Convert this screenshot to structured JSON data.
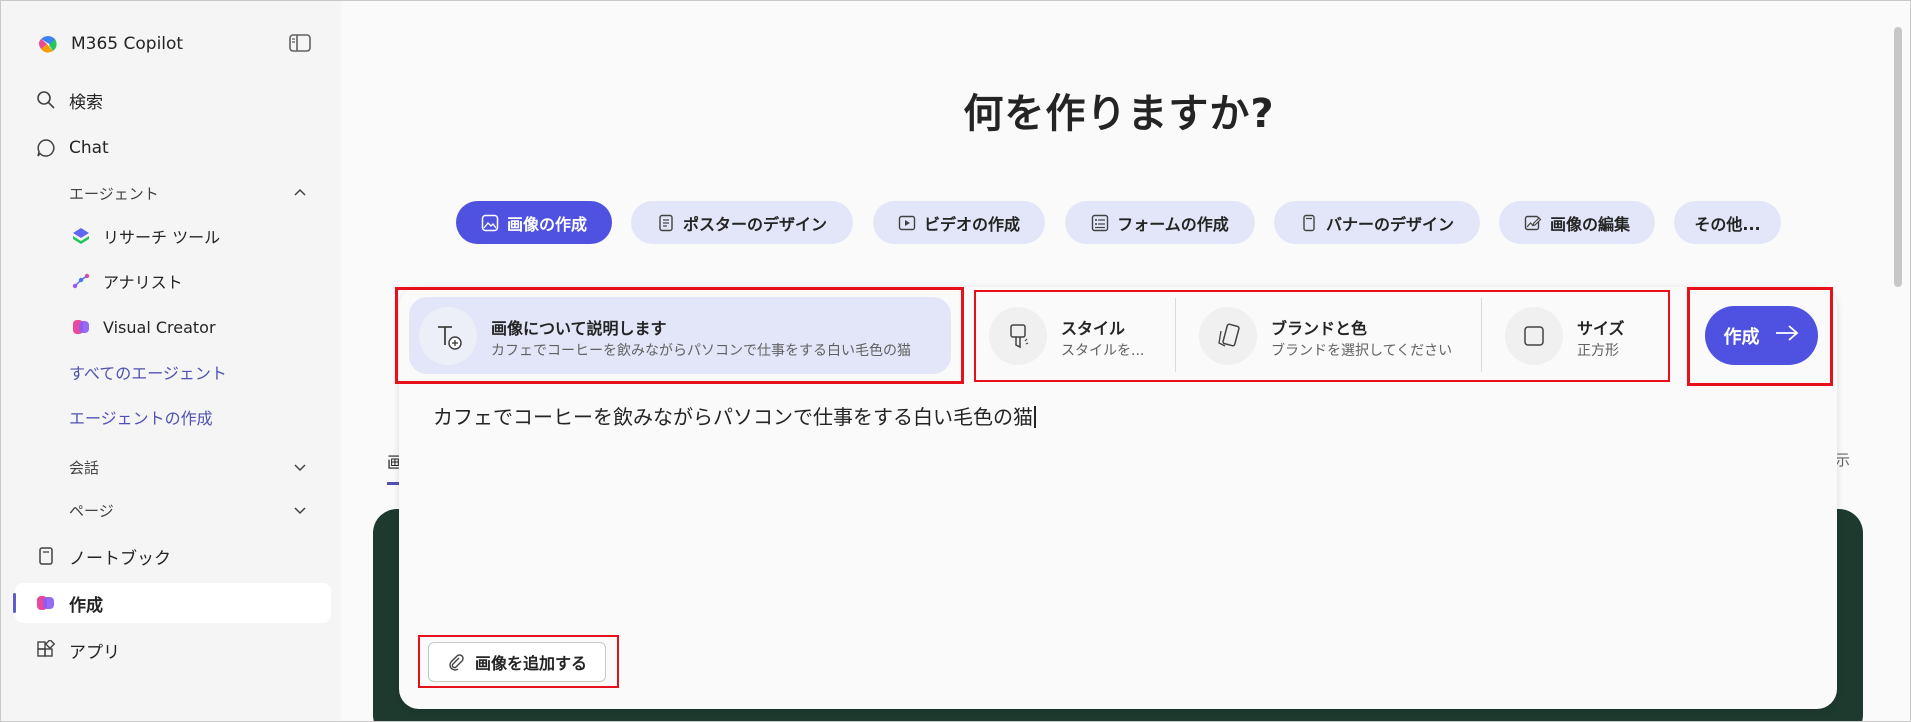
{
  "app": {
    "title": "M365 Copilot"
  },
  "sidebar": {
    "items": [
      {
        "label": "検索",
        "icon": "search-icon"
      },
      {
        "label": "Chat",
        "icon": "chat-icon"
      },
      {
        "label": "ノートブック",
        "icon": "notebook-icon"
      },
      {
        "label": "作成",
        "icon": "create-icon"
      },
      {
        "label": "アプリ",
        "icon": "apps-icon"
      }
    ],
    "agents_header": "エージェント",
    "agents": [
      {
        "label": "リサーチ ツール",
        "icon": "research-agent-icon"
      },
      {
        "label": "アナリスト",
        "icon": "analyst-agent-icon"
      },
      {
        "label": "Visual Creator",
        "icon": "visual-creator-icon"
      }
    ],
    "all_agents": "すべてのエージェント",
    "create_agent": "エージェントの作成",
    "conversations": "会話",
    "pages": "ページ"
  },
  "main": {
    "heading": "何を作りますか?",
    "pills": [
      {
        "label": "画像の作成",
        "icon": "image-icon",
        "active": true
      },
      {
        "label": "ポスターのデザイン",
        "icon": "poster-icon"
      },
      {
        "label": "ビデオの作成",
        "icon": "video-icon"
      },
      {
        "label": "フォームの作成",
        "icon": "form-icon"
      },
      {
        "label": "バナーのデザイン",
        "icon": "banner-icon"
      },
      {
        "label": "画像の編集",
        "icon": "edit-image-icon"
      },
      {
        "label": "その他..."
      }
    ],
    "bg_tab_partial": "画",
    "bg_right_partial": "示"
  },
  "composer": {
    "describe_title": "画像について説明します",
    "describe_subtitle": "カフェでコーヒーを飲みながらパソコンで仕事をする白い毛色の猫",
    "style_title": "スタイル",
    "style_value": "スタイルを...",
    "brand_title": "ブランドと色",
    "brand_value": "ブランドを選択してください",
    "size_title": "サイズ",
    "size_value": "正方形",
    "create_label": "作成",
    "prompt_text": "カフェでコーヒーを飲みながらパソコンで仕事をする白い毛色の猫",
    "add_image_label": "画像を追加する"
  },
  "colors": {
    "accent": "#4f52e0",
    "pill_bg": "#e3e6f8",
    "highlight": "#e8101b",
    "link": "#4f52b2"
  }
}
